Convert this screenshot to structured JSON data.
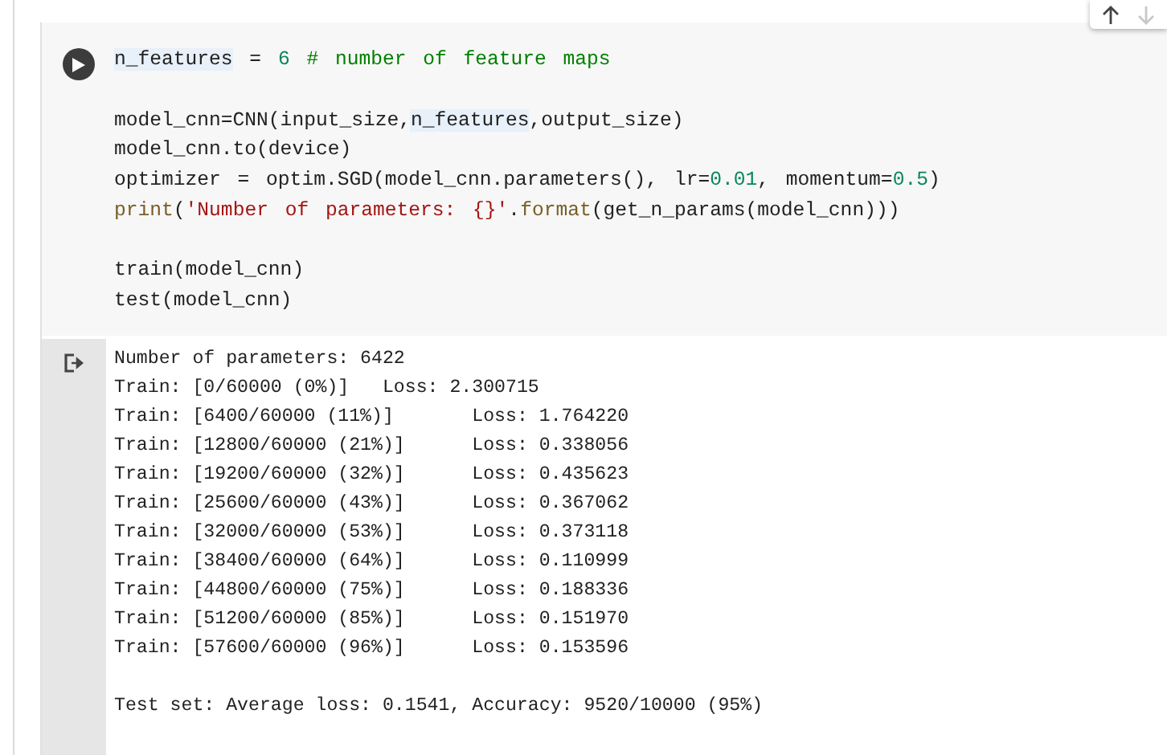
{
  "toolbar": [
    {
      "kind": "up",
      "disabled": false
    },
    {
      "kind": "down",
      "disabled": true
    }
  ],
  "code_cell": {
    "blocks": [
      [
        [
          {
            "text": "n_features",
            "kind": "match"
          },
          {
            "text": " = ",
            "kind": "plain"
          },
          {
            "text": "6",
            "kind": "number"
          },
          {
            "text": " # number of feature maps",
            "kind": "comment"
          }
        ]
      ],
      [
        [
          {
            "text": "model_cnn=CNN(input_size,",
            "kind": "plain"
          },
          {
            "text": "n_features",
            "kind": "match"
          },
          {
            "text": ",output_size)",
            "kind": "plain"
          }
        ],
        [
          {
            "text": "model_cnn.to(device)",
            "kind": "plain"
          }
        ],
        [
          {
            "text": "optimizer = optim.SGD(model_cnn.parameters(), lr=",
            "kind": "plain"
          },
          {
            "text": "0.01",
            "kind": "number"
          },
          {
            "text": ", momentum=",
            "kind": "plain"
          },
          {
            "text": "0.5",
            "kind": "number"
          },
          {
            "text": ")",
            "kind": "plain"
          }
        ],
        [
          {
            "text": "print",
            "kind": "builtin"
          },
          {
            "text": "(",
            "kind": "plain"
          },
          {
            "text": "'Number of parameters: {}'",
            "kind": "string"
          },
          {
            "text": ".",
            "kind": "plain"
          },
          {
            "text": "format",
            "kind": "builtin"
          },
          {
            "text": "(get_n_params(model_cnn)))",
            "kind": "plain"
          }
        ]
      ],
      [
        [
          {
            "text": "train(model_cnn)",
            "kind": "plain"
          }
        ],
        [
          {
            "text": "test(model_cnn)",
            "kind": "plain"
          }
        ]
      ]
    ]
  },
  "output": {
    "blocks": [
      [
        "Number of parameters: 6422",
        "Train: [0/60000 (0%)]   Loss: 2.300715",
        "Train: [6400/60000 (11%)]       Loss: 1.764220",
        "Train: [12800/60000 (21%)]      Loss: 0.338056",
        "Train: [19200/60000 (32%)]      Loss: 0.435623",
        "Train: [25600/60000 (43%)]      Loss: 0.367062",
        "Train: [32000/60000 (53%)]      Loss: 0.373118",
        "Train: [38400/60000 (64%)]      Loss: 0.110999",
        "Train: [44800/60000 (75%)]      Loss: 0.188336",
        "Train: [51200/60000 (85%)]      Loss: 0.151970",
        "Train: [57600/60000 (96%)]      Loss: 0.153596"
      ],
      [
        "Test set: Average loss: 0.1541, Accuracy: 9520/10000 (95%)"
      ]
    ]
  }
}
